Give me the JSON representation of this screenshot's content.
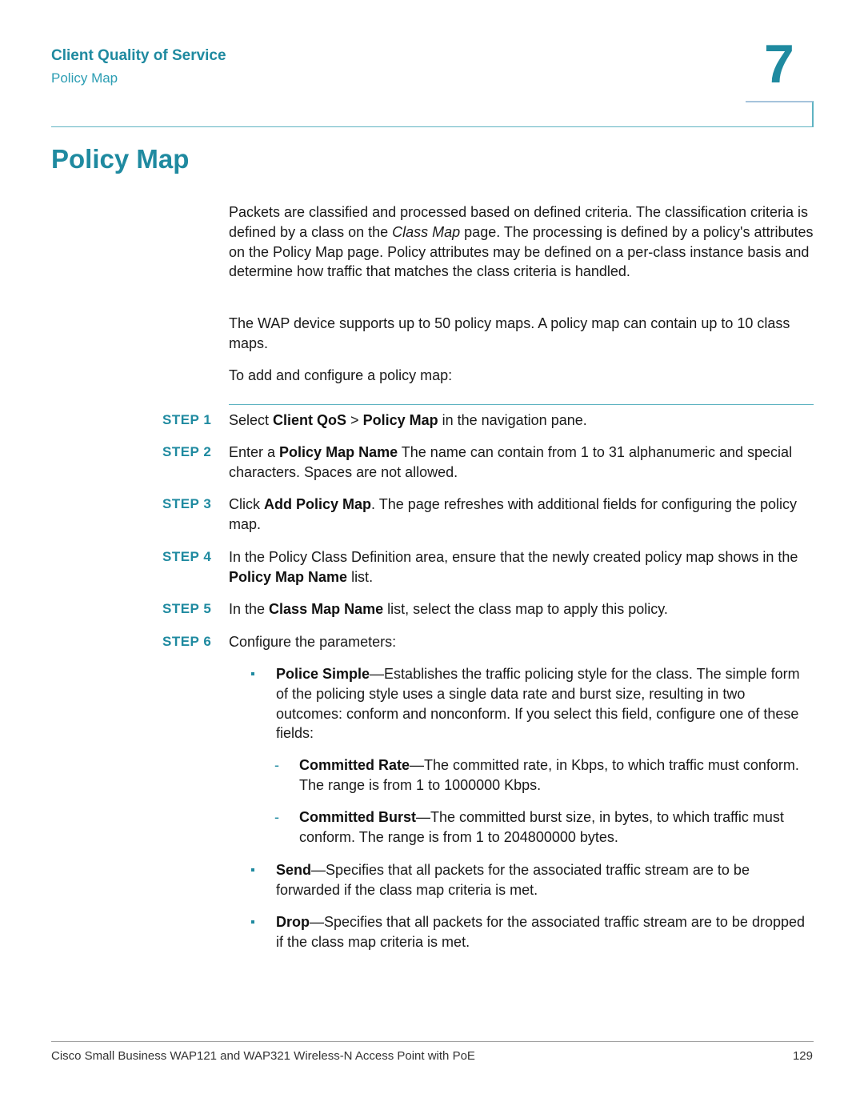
{
  "header": {
    "chapter_title": "Client Quality of Service",
    "section": "Policy Map",
    "chapter_number": "7"
  },
  "page_heading": "Policy Map",
  "intro": {
    "p1": [
      "Packets are classified and processed based on defined criteria. The classification criteria is defined by a class on the ",
      "Class Map",
      " page. The processing is defined by a policy's attributes on the Policy Map page. Policy attributes may be defined on a per-class instance basis and determine how traffic that matches the class criteria is handled."
    ],
    "p2": "The WAP device supports up to 50 policy maps. A policy map can contain up to 10 class maps.",
    "p3": "To add and configure a policy map:"
  },
  "steps": [
    {
      "label": "STEP  1",
      "parts": [
        "Select ",
        "Client QoS",
        " > ",
        "Policy Map",
        " in the navigation pane."
      ]
    },
    {
      "label": "STEP  2",
      "parts": [
        "Enter a ",
        "Policy Map Name",
        " The name can contain from 1 to 31 alphanumeric and special characters. Spaces are not allowed."
      ]
    },
    {
      "label": "STEP  3",
      "parts": [
        "Click ",
        "Add Policy Map",
        ". The page refreshes with additional fields for configuring the policy map."
      ]
    },
    {
      "label": "STEP  4",
      "parts": [
        "In the Policy Class Definition area, ensure that the newly created policy map shows in the ",
        "Policy Map Name",
        " list."
      ]
    },
    {
      "label": "STEP  5",
      "parts": [
        "In the ",
        "Class Map Name",
        " list, select the class map to apply this policy."
      ]
    },
    {
      "label": "STEP  6",
      "parts": [
        "Configure the parameters:"
      ]
    }
  ],
  "parameters": {
    "police_simple": {
      "term": "Police Simple",
      "desc": "—Establishes the traffic policing style for the class. The simple form of the policing style uses a single data rate and burst size, resulting in two outcomes: conform and nonconform. If you select this field, configure one of these fields:"
    },
    "committed_rate": {
      "term": "Committed Rate",
      "desc": "—The committed rate, in Kbps, to which traffic must conform. The range is from 1 to 1000000 Kbps."
    },
    "committed_burst": {
      "term": "Committed Burst",
      "desc": "—The committed burst size, in bytes, to which traffic must conform. The range is from 1 to 204800000 bytes."
    },
    "send": {
      "term": "Send",
      "desc": "—Specifies that all packets for the associated traffic stream are to be forwarded if the class map criteria is met."
    },
    "drop": {
      "term": "Drop",
      "desc": "—Specifies that all packets for the associated traffic stream are to be dropped if the class map criteria is met."
    },
    "dash_symbol": "-"
  },
  "footer": {
    "text": "Cisco Small Business WAP121 and WAP321 Wireless-N Access Point with PoE",
    "page_number": "129"
  }
}
